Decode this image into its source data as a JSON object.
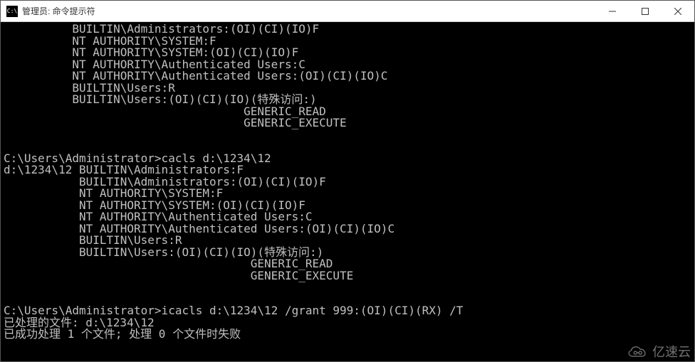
{
  "window": {
    "title": "管理员: 命令提示符",
    "icon_glyph": "C:\\"
  },
  "terminal_lines": [
    "          BUILTIN\\Administrators:(OI)(CI)(IO)F",
    "          NT AUTHORITY\\SYSTEM:F",
    "          NT AUTHORITY\\SYSTEM:(OI)(CI)(IO)F",
    "          NT AUTHORITY\\Authenticated Users:C",
    "          NT AUTHORITY\\Authenticated Users:(OI)(CI)(IO)C",
    "          BUILTIN\\Users:R",
    "          BUILTIN\\Users:(OI)(CI)(IO)(特殊访问:)",
    "                                   GENERIC_READ",
    "                                   GENERIC_EXECUTE",
    "",
    "",
    "C:\\Users\\Administrator>cacls d:\\1234\\12",
    "d:\\1234\\12 BUILTIN\\Administrators:F",
    "           BUILTIN\\Administrators:(OI)(CI)(IO)F",
    "           NT AUTHORITY\\SYSTEM:F",
    "           NT AUTHORITY\\SYSTEM:(OI)(CI)(IO)F",
    "           NT AUTHORITY\\Authenticated Users:C",
    "           NT AUTHORITY\\Authenticated Users:(OI)(CI)(IO)C",
    "           BUILTIN\\Users:R",
    "           BUILTIN\\Users:(OI)(CI)(IO)(特殊访问:)",
    "                                    GENERIC_READ",
    "                                    GENERIC_EXECUTE",
    "",
    "",
    "C:\\Users\\Administrator>icacls d:\\1234\\12 /grant 999:(OI)(CI)(RX) /T",
    "已处理的文件: d:\\1234\\12",
    "已成功处理 1 个文件; 处理 0 个文件时失败"
  ],
  "watermark": {
    "text": "亿速云"
  }
}
